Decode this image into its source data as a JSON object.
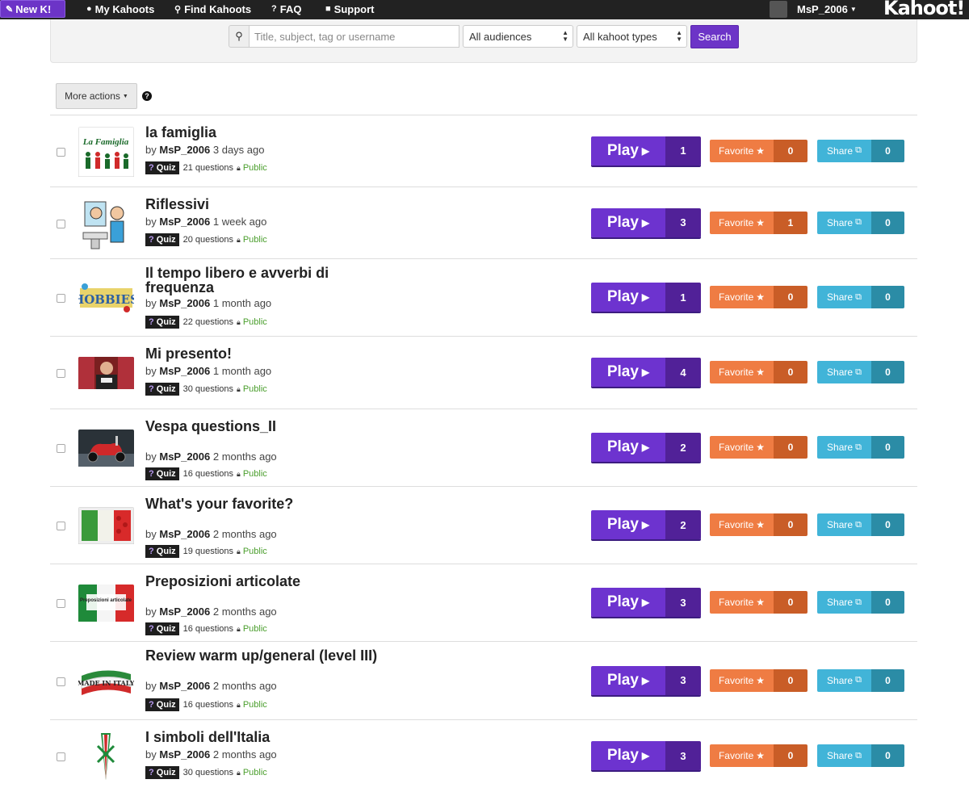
{
  "nav": {
    "new_label": "New K!",
    "items": [
      {
        "label": "My Kahoots",
        "icon": "user-icon"
      },
      {
        "label": "Find Kahoots",
        "icon": "search-icon"
      },
      {
        "label": "FAQ",
        "icon": "question-icon"
      },
      {
        "label": "Support",
        "icon": "chat-icon"
      }
    ],
    "username": "MsP_2006",
    "logo": "Kahoot!"
  },
  "search": {
    "placeholder": "Title, subject, tag or username",
    "audience": "All audiences",
    "types": "All kahoot types",
    "button": "Search"
  },
  "toolbar": {
    "more_actions": "More actions"
  },
  "kahoots": [
    {
      "title": "la famiglia",
      "author": "MsP_2006",
      "ago": "3 days ago",
      "type": "Quiz",
      "questions": "21 questions",
      "visibility": "Public",
      "plays": "1",
      "favorites": "0",
      "shares": "0"
    },
    {
      "title": "Riflessivi",
      "author": "MsP_2006",
      "ago": "1 week ago",
      "type": "Quiz",
      "questions": "20 questions",
      "visibility": "Public",
      "plays": "3",
      "favorites": "1",
      "shares": "0"
    },
    {
      "title": "Il tempo libero e avverbi di frequenza",
      "author": "MsP_2006",
      "ago": "1 month ago",
      "type": "Quiz",
      "questions": "22 questions",
      "visibility": "Public",
      "plays": "1",
      "favorites": "0",
      "shares": "0"
    },
    {
      "title": "Mi presento!",
      "author": "MsP_2006",
      "ago": "1 month ago",
      "type": "Quiz",
      "questions": "30 questions",
      "visibility": "Public",
      "plays": "4",
      "favorites": "0",
      "shares": "0"
    },
    {
      "title": "Vespa questions_II",
      "author": "MsP_2006",
      "ago": "2 months ago",
      "type": "Quiz",
      "questions": "16 questions",
      "visibility": "Public",
      "plays": "2",
      "favorites": "0",
      "shares": "0"
    },
    {
      "title": "What's your favorite?",
      "author": "MsP_2006",
      "ago": "2 months ago",
      "type": "Quiz",
      "questions": "19 questions",
      "visibility": "Public",
      "plays": "2",
      "favorites": "0",
      "shares": "0"
    },
    {
      "title": "Preposizioni articolate",
      "author": "MsP_2006",
      "ago": "2 months ago",
      "type": "Quiz",
      "questions": "16 questions",
      "visibility": "Public",
      "plays": "3",
      "favorites": "0",
      "shares": "0"
    },
    {
      "title": "Review warm up/general (level III)",
      "author": "MsP_2006",
      "ago": "2 months ago",
      "type": "Quiz",
      "questions": "16 questions",
      "visibility": "Public",
      "plays": "3",
      "favorites": "0",
      "shares": "0"
    },
    {
      "title": "I simboli dell'Italia",
      "author": "MsP_2006",
      "ago": "2 months ago",
      "type": "Quiz",
      "questions": "30 questions",
      "visibility": "Public",
      "plays": "3",
      "favorites": "0",
      "shares": "0"
    }
  ],
  "thumb_text": {
    "famiglia": "La Famiglia",
    "hobbies": "HOBBIES",
    "preposizioni": "Preposizioni articolate",
    "made_in_italy": "MADE IN ITALY"
  },
  "labels": {
    "by": "by",
    "play": "Play",
    "favorite": "Favorite",
    "share": "Share"
  },
  "colors": {
    "brand": "#6c34c7",
    "favorite": "#ef7c43",
    "share": "#41b4d8",
    "public": "#4a9e2c"
  }
}
